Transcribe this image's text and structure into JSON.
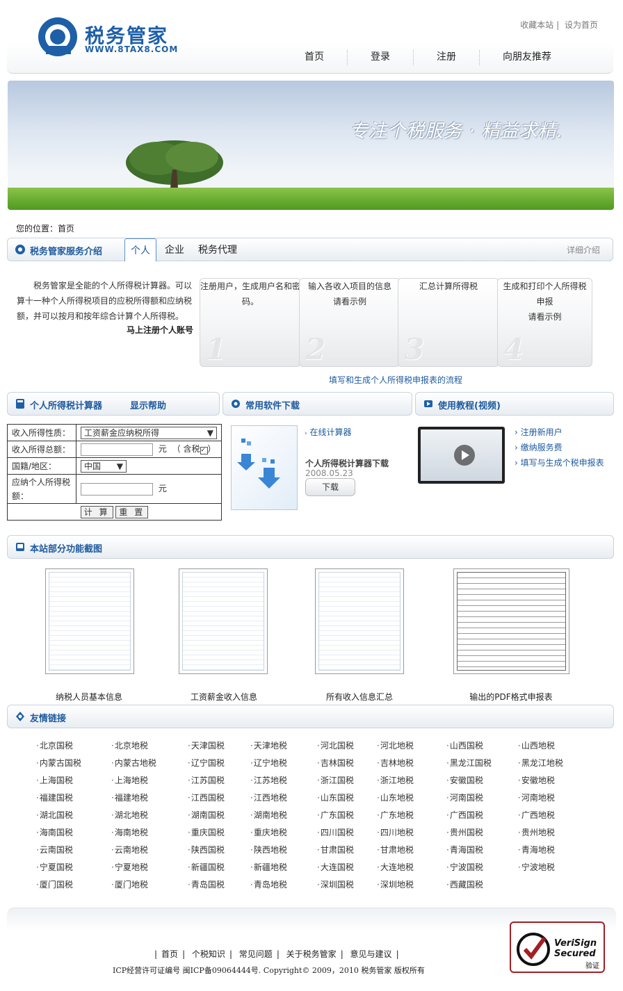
{
  "header": {
    "logo_text": "税务管家",
    "logo_url": "WWW.8TAX8.COM",
    "top_links": [
      "收藏本站",
      "设为首页"
    ],
    "nav": [
      "首页",
      "登录",
      "注册",
      "向朋友推荐"
    ]
  },
  "banner": {
    "slogan": "专注个税服务 · 精益求精."
  },
  "breadcrumb": {
    "label": "您的位置：",
    "current": "首页"
  },
  "service": {
    "title": "税务管家服务介绍",
    "tabs": [
      "个人",
      "企业",
      "税务代理"
    ],
    "detail_link": "详细介绍",
    "intro": "税务管家是全能的个人所得税计算器。可以算十一种个人所得税项目的应税所得额和应纳税额，并可以按月和按年综合计算个人所得税。",
    "register_link": "马上注册个人账号",
    "steps": [
      {
        "num": "1",
        "text": "注册用户，生成用户名和密码。",
        "link": ""
      },
      {
        "num": "2",
        "text": "输入各收入项目的信息",
        "link": "请看示例"
      },
      {
        "num": "3",
        "text": "汇总计算所得税",
        "link": ""
      },
      {
        "num": "4",
        "text": "生成和打印个人所得税申报",
        "link": "请看示例"
      }
    ],
    "flow_link": "填写和生成个人所得税申报表的流程"
  },
  "calculator": {
    "title": "个人所得税计算器",
    "help": "显示帮助",
    "rows": {
      "income_type_label": "收入所得性质：",
      "income_type_value": "工资薪金应纳税所得",
      "total_label": "收入所得总额：",
      "unit": "元",
      "tax_included": "（ 含税",
      "tax_included_close": "）",
      "region_label": "国籍/地区：",
      "region_value": "中国",
      "payable_label": "应纳个人所得税额："
    },
    "calc_button": "计 算",
    "reset_button": "重 置"
  },
  "software": {
    "title": "常用软件下载",
    "online_link": "在线计算器",
    "item_title": "个人所得税计算器下载",
    "item_date": "2008.05.23",
    "download_button": "下载"
  },
  "tutorial": {
    "title": "使用教程(视频)",
    "links": [
      "注册新用户",
      "缴纳服务费",
      "填写与生成个税申报表"
    ]
  },
  "screenshots": {
    "title": "本站部分功能截图",
    "captions": [
      "纳税人员基本信息",
      "工资薪金收入信息",
      "所有收入信息汇总",
      "输出的PDF格式申报表"
    ]
  },
  "friend_links": {
    "title": "友情链接",
    "items": [
      [
        "北京国税",
        "北京地税",
        "天津国税",
        "天津地税",
        "河北国税",
        "河北地税",
        "山西国税",
        "山西地税"
      ],
      [
        "内蒙古国税",
        "内蒙古地税",
        "辽宁国税",
        "辽宁地税",
        "吉林国税",
        "吉林地税",
        "黑龙江国税",
        "黑龙江地税"
      ],
      [
        "上海国税",
        "上海地税",
        "江苏国税",
        "江苏地税",
        "浙江国税",
        "浙江地税",
        "安徽国税",
        "安徽地税"
      ],
      [
        "福建国税",
        "福建地税",
        "江西国税",
        "江西地税",
        "山东国税",
        "山东地税",
        "河南国税",
        "河南地税"
      ],
      [
        "湖北国税",
        "湖北地税",
        "湖南国税",
        "湖南地税",
        "广东国税",
        "广东地税",
        "广西国税",
        "广西地税"
      ],
      [
        "海南国税",
        "海南地税",
        "重庆国税",
        "重庆地税",
        "四川国税",
        "四川地税",
        "贵州国税",
        "贵州地税"
      ],
      [
        "云南国税",
        "云南地税",
        "陕西国税",
        "陕西地税",
        "甘肃国税",
        "甘肃地税",
        "青海国税",
        "青海地税"
      ],
      [
        "宁夏国税",
        "宁夏地税",
        "新疆国税",
        "新疆地税",
        "大连国税",
        "大连地税",
        "宁波国税",
        "宁波地税"
      ],
      [
        "厦门国税",
        "厦门地税",
        "青岛国税",
        "青岛地税",
        "深圳国税",
        "深圳地税",
        "西藏国税"
      ]
    ]
  },
  "footer": {
    "nav": [
      "首页",
      "个税知识",
      "常见问题",
      "关于税务管家",
      "意见与建议"
    ],
    "copyright": "ICP经营许可证编号 闽ICP备09064444号.  Copyright© 2009，2010 税务管家 版权所有",
    "verisign_line1": "VeriSign",
    "verisign_line2": "Secured",
    "verisign_verify": "验证"
  }
}
